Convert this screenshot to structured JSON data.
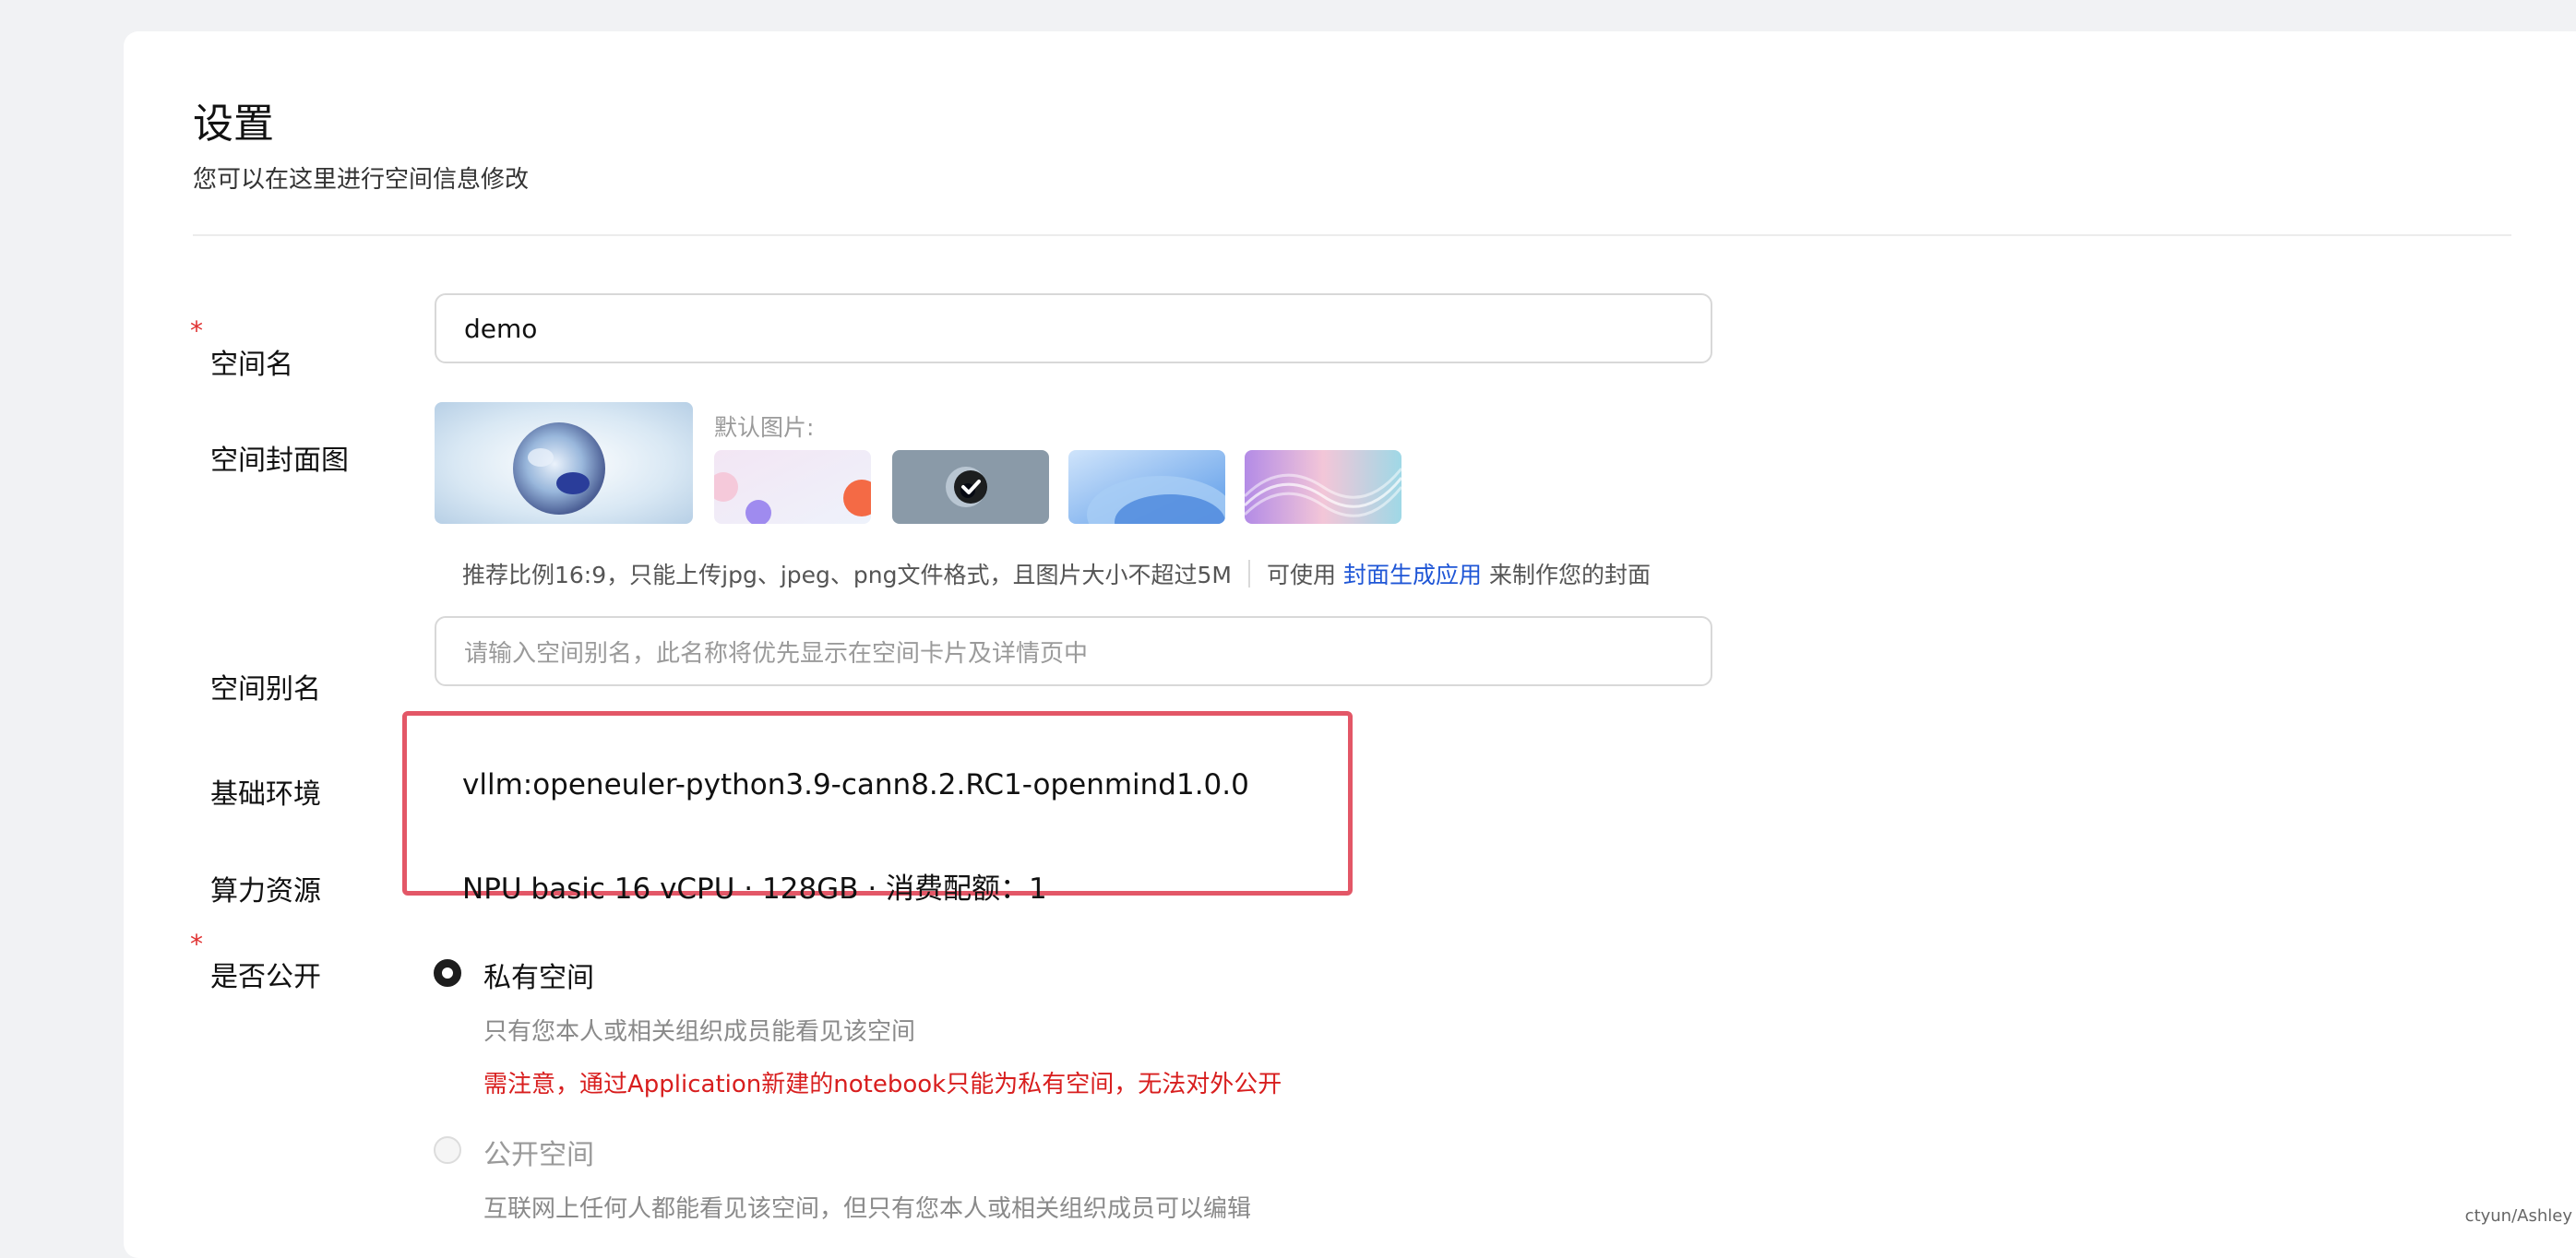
{
  "page": {
    "title": "设置",
    "subtitle": "您可以在这里进行空间信息修改"
  },
  "form": {
    "space_name": {
      "label": "空间名",
      "required_mark": "*",
      "value": "demo"
    },
    "cover": {
      "label": "空间封面图",
      "default_label": "默认图片:",
      "hint": "推荐比例16:9，只能上传jpg、jpeg、png文件格式，且图片大小不超过5M",
      "hint_use": "可使用",
      "hint_link": "封面生成应用",
      "hint_suffix": "来制作您的封面",
      "selected_index": 1
    },
    "alias": {
      "label": "空间别名",
      "placeholder": "请输入空间别名，此名称将优先显示在空间卡片及详情页中"
    },
    "environment": {
      "label": "基础环境",
      "value": "vllm:openeuler-python3.9-cann8.2.RC1-openmind1.0.0"
    },
    "compute": {
      "label": "算力资源",
      "value": "NPU basic 16 vCPU · 128GB · 消费配额：1"
    },
    "visibility": {
      "label": "是否公开",
      "required_mark": "*",
      "private_label": "私有空间",
      "private_desc": "只有您本人或相关组织成员能看见该空间",
      "private_warning": "需注意，通过Application新建的notebook只能为私有空间，无法对外公开",
      "public_label": "公开空间",
      "public_desc": "互联网上任何人都能看见该空间，但只有您本人或相关组织成员可以编辑",
      "selected": "private"
    }
  },
  "colors": {
    "accent_link": "#1f56d6",
    "required": "#e03030",
    "warning": "#d81e1e",
    "highlight_border": "#e35767"
  },
  "watermark": "ctyun/Ashley"
}
